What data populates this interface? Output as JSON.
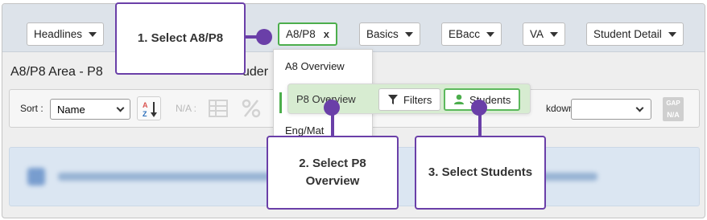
{
  "nav": {
    "items": [
      {
        "label": "Headlines"
      },
      {
        "label": "A8/P8",
        "close": "x"
      },
      {
        "label": "Basics"
      },
      {
        "label": "EBacc"
      },
      {
        "label": "VA"
      },
      {
        "label": "Student Detail"
      }
    ]
  },
  "page": {
    "heading_left": "A8/P8 Area - P8",
    "heading_right": "uder"
  },
  "toolbar": {
    "sort_label": "Sort :",
    "sort_value": "Name",
    "na_label": "N/A :",
    "breakdown_label": "kdown :",
    "gap_label": "GAP",
    "gap_value": "N/A"
  },
  "menu": {
    "items": [
      "A8 Overview",
      "P8 Overview",
      "Eng/Mat"
    ]
  },
  "actions": {
    "filters_label": "Filters",
    "students_label": "Students"
  },
  "callouts": {
    "step1": "1. Select A8/P8",
    "step2": "2. Select P8 Overview",
    "step3": "3. Select Students"
  },
  "colors": {
    "callout_purple": "#6a3fa8",
    "selected_green": "#4cae4c",
    "topbar_bg": "#dde3ea",
    "banner_bg": "#dbe6f2"
  },
  "icons": {
    "sort": "sort-az-icon",
    "filter": "funnel-icon",
    "student": "user-icon"
  }
}
